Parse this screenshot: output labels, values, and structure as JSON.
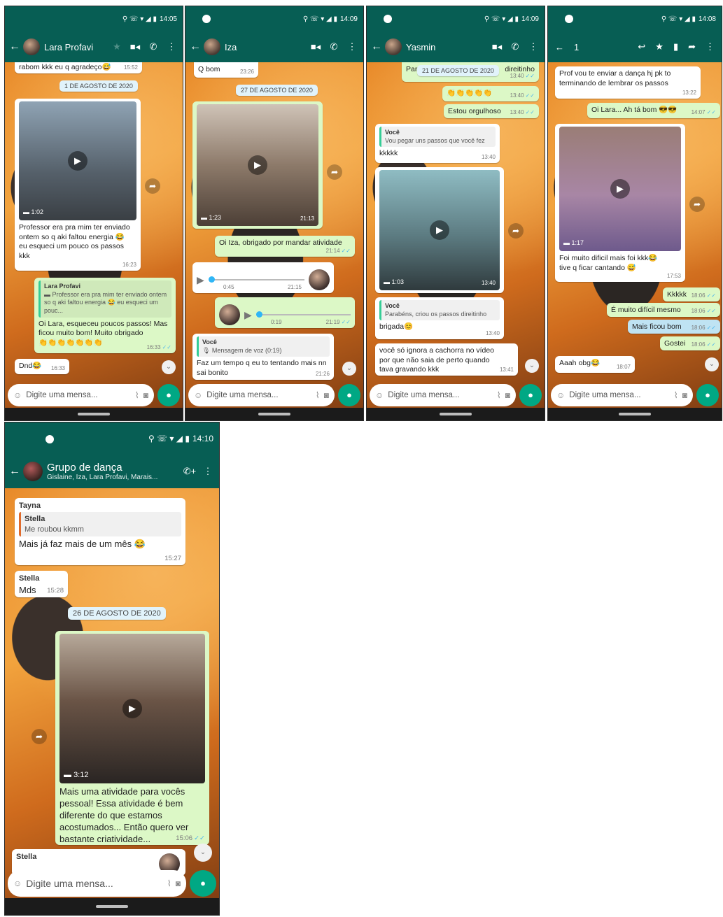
{
  "status": {
    "time1": "14:05",
    "time2": "14:09",
    "time3": "14:09",
    "time4": "14:08",
    "time5": "14:10"
  },
  "input": {
    "placeholder": "Digite uma mensa..."
  },
  "icons": {
    "video": "video-call-icon",
    "call": "phone-call-icon",
    "menu": "more-vert-icon",
    "back": "arrow-back-icon",
    "mic": "mic-icon",
    "attach": "attach-icon",
    "camera": "camera-icon",
    "emoji": "emoji-icon"
  },
  "colors": {
    "header": "#075e54",
    "outgoing": "#dcf8c6",
    "incoming": "#ffffff",
    "accent": "#00a884"
  },
  "p1": {
    "title": "Lara Profavi",
    "top_msg": "rabom kkk eu q agradeço😅",
    "top_time": "15:52",
    "date": "1 DE AGOSTO DE 2020",
    "video_dur": "1:02",
    "caption": "Professor era pra mim ter enviado ontem so q aki faltou energia 😂 eu esqueci um pouco os passos kkk",
    "caption_time": "16:23",
    "reply_name": "Lara Profavi",
    "reply_quote": "▬ Professor era pra mim ter enviado ontem so q aki faltou energia 😂 eu esqueci um pouc...",
    "reply_text": "Oi Lara, esqueceu poucos passos! Mas ficou muito bom! Muito obrigado",
    "reply_emojis": "👏👏👏👏👏👏👏",
    "reply_time": "16:33",
    "dnd": "Dnd😂",
    "dnd_time": "16:33"
  },
  "p2": {
    "title": "Iza",
    "top_msg": "Q bom",
    "top_time": "23:26",
    "date": "27 DE AGOSTO DE 2020",
    "video_dur": "1:23",
    "video_time": "21:13",
    "thanks": "Oi Iza, obrigado por mandar atividade",
    "thanks_time": "21:14",
    "audio1_dur": "0:45",
    "audio1_time": "21:15",
    "audio2_dur": "0:19",
    "audio2_time": "21:19",
    "quote_name": "Você",
    "quote_text": "🎙 Mensagem de voz (0:19)",
    "reply": "Faz um tempo q eu to tentando mais nn sai bonito",
    "reply_time": "21:26"
  },
  "p3": {
    "title": "Yasmin",
    "top_left": "Para",
    "date": "21 DE AGOSTO DE 2020",
    "top_right": "direitinho",
    "top_time": "13:40",
    "claps": "👏👏👏👏👏",
    "claps_time": "13:40",
    "proud": "Estou orgulhoso",
    "proud_time": "13:40",
    "quote1_name": "Você",
    "quote1_text": "Vou pegar uns passos que você fez",
    "kkk": "kkkkk",
    "kkk_time": "13:40",
    "video_dur": "1:03",
    "video_time": "13:40",
    "quote2_name": "Você",
    "quote2_text": "Parabéns, criou os passos direitinho",
    "thanks": "brigada😊",
    "thanks_time": "13:40",
    "last": "você só ignora a cachorra no vídeo por que não saia de perto quando tava gravando kkk",
    "last_time": "13:41"
  },
  "p4": {
    "sel_count": "1",
    "first": "Prof vou te enviar a dança hj pk to terminando de lembrar os passos",
    "first_time": "13:22",
    "out1": "Oi Lara... Ah tá bom 😎😎",
    "out1_time": "14:07",
    "video_dur": "1:17",
    "caption": "Foi muito dificil mais foi kkk😂 tive q ficar cantando 😅",
    "caption_time": "17:53",
    "o1": "Kkkkk",
    "o1_time": "18:06",
    "o2": "É muito difícil mesmo",
    "o2_time": "18:06",
    "o3": "Mais ficou bom",
    "o3_time": "18:06",
    "o4": "Gostei",
    "o4_time": "18:06",
    "last": "Aaah obg😂",
    "last_time": "18:07"
  },
  "p5": {
    "title": "Grupo de dança",
    "subtitle": "Gislaine, Iza, Lara Profavi, Marais...",
    "m1_sender": "Tayna",
    "m1_qname": "Stella",
    "m1_qtext": "Me roubou kkmm",
    "m1_text": "Mais já faz mais de um mês 😂",
    "m1_time": "15:27",
    "m2_sender": "Stella",
    "m2_text": "Mds",
    "m2_time": "15:28",
    "date": "26 DE AGOSTO DE 2020",
    "video_dur": "3:12",
    "caption": "Mais uma atividade para vocês pessoal! Essa atividade é bem diferente do que estamos acostumados... Então quero ver bastante criatividade...",
    "caption_time": "15:06",
    "m3_sender": "Stella"
  }
}
